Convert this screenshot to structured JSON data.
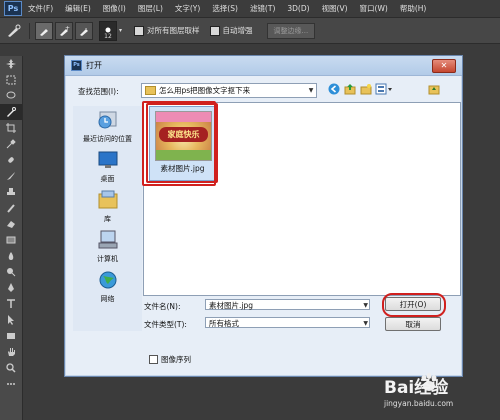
{
  "app": {
    "logo": "Ps"
  },
  "menu": [
    "文件(F)",
    "编辑(E)",
    "图像(I)",
    "图层(L)",
    "文字(Y)",
    "选择(S)",
    "滤镜(T)",
    "3D(D)",
    "视图(V)",
    "窗口(W)",
    "帮助(H)"
  ],
  "options": {
    "brush_size": "12",
    "sample_all_layers": "对所有图层取样",
    "auto_enhance": "自动增强",
    "refine_edge": "调整边缘..."
  },
  "dialog": {
    "title": "打开",
    "look_in_label": "查找范围(I):",
    "look_in_value": "怎么用ps把图像文字抠下来",
    "places": [
      "最近访问的位置",
      "桌面",
      "库",
      "计算机",
      "网络"
    ],
    "file": {
      "name": "素材图片.jpg",
      "thumb_text": "家庭快乐"
    },
    "filename_label": "文件名(N):",
    "filename_value": "素材图片.jpg",
    "filetype_label": "文件类型(T):",
    "filetype_value": "所有格式",
    "open_button": "打开(O)",
    "cancel_button": "取消",
    "image_sequence": "图像序列"
  },
  "watermark": {
    "brand": "Bai经验",
    "url": "jingyan.baidu.com"
  },
  "colors": {
    "highlight_red": "#d0201e",
    "dialog_bg": "#e7eef7",
    "ps_bg": "#3b3b3b"
  }
}
